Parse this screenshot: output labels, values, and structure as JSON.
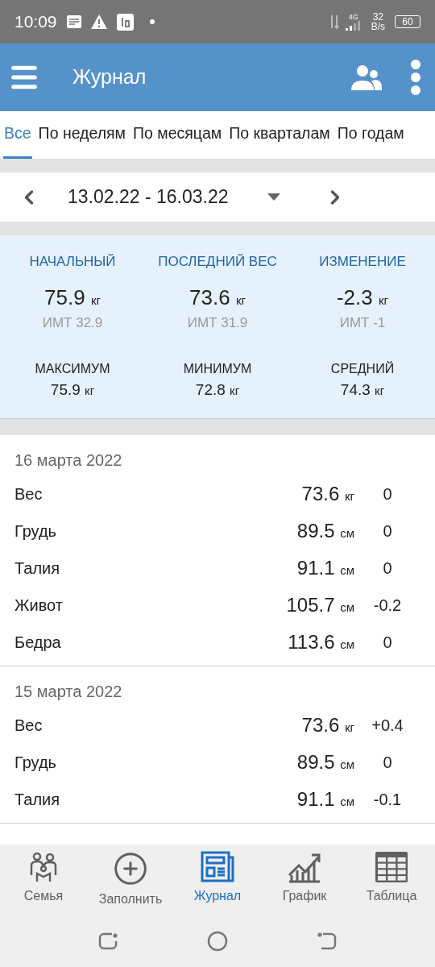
{
  "status_bar": {
    "time": "10:09",
    "network": "4G",
    "speed": [
      "32",
      "B/s"
    ],
    "battery": "60"
  },
  "header": {
    "title": "Журнал"
  },
  "tabs": [
    {
      "label": "Все",
      "selected": true
    },
    {
      "label": "По неделям",
      "selected": false
    },
    {
      "label": "По месяцам",
      "selected": false
    },
    {
      "label": "По кварталам",
      "selected": false
    },
    {
      "label": "По годам",
      "selected": false
    }
  ],
  "date_range": "13.02.22 - 16.03.22",
  "summary": [
    {
      "label": "НАЧАЛЬНЫЙ",
      "value": "75.9",
      "unit": "кг",
      "bmi": "ИМТ 32.9"
    },
    {
      "label": "ПОСЛЕДНИЙ ВЕС",
      "value": "73.6",
      "unit": "кг",
      "bmi": "ИМТ 31.9"
    },
    {
      "label": "ИЗМЕНЕНИЕ",
      "value": "-2.3",
      "unit": "кг",
      "bmi": "ИМТ -1"
    }
  ],
  "extremes": [
    {
      "label": "МАКСИМУМ",
      "value": "75.9",
      "unit": "кг"
    },
    {
      "label": "МИНИМУМ",
      "value": "72.8",
      "unit": "кг"
    },
    {
      "label": "СРЕДНИЙ",
      "value": "74.3",
      "unit": "кг"
    }
  ],
  "entries": [
    {
      "date": "16 марта 2022",
      "rows": [
        {
          "name": "Вес",
          "value": "73.6",
          "unit": "кг",
          "change": "0"
        },
        {
          "name": "Грудь",
          "value": "89.5",
          "unit": "см",
          "change": "0"
        },
        {
          "name": "Талия",
          "value": "91.1",
          "unit": "см",
          "change": "0"
        },
        {
          "name": "Живот",
          "value": "105.7",
          "unit": "см",
          "change": "-0.2"
        },
        {
          "name": "Бедра",
          "value": "113.6",
          "unit": "см",
          "change": "0"
        }
      ]
    },
    {
      "date": "15 марта 2022",
      "rows": [
        {
          "name": "Вес",
          "value": "73.6",
          "unit": "кг",
          "change": "+0.4"
        },
        {
          "name": "Грудь",
          "value": "89.5",
          "unit": "см",
          "change": "0"
        },
        {
          "name": "Талия",
          "value": "91.1",
          "unit": "см",
          "change": "-0.1"
        }
      ]
    }
  ],
  "bottom_nav": [
    {
      "label": "Семья",
      "kind": "family",
      "selected": false
    },
    {
      "label": "Заполнить",
      "kind": "add",
      "selected": false
    },
    {
      "label": "Журнал",
      "kind": "journal",
      "selected": true
    },
    {
      "label": "График",
      "kind": "chart",
      "selected": false
    },
    {
      "label": "Таблица",
      "kind": "table",
      "selected": false
    }
  ]
}
